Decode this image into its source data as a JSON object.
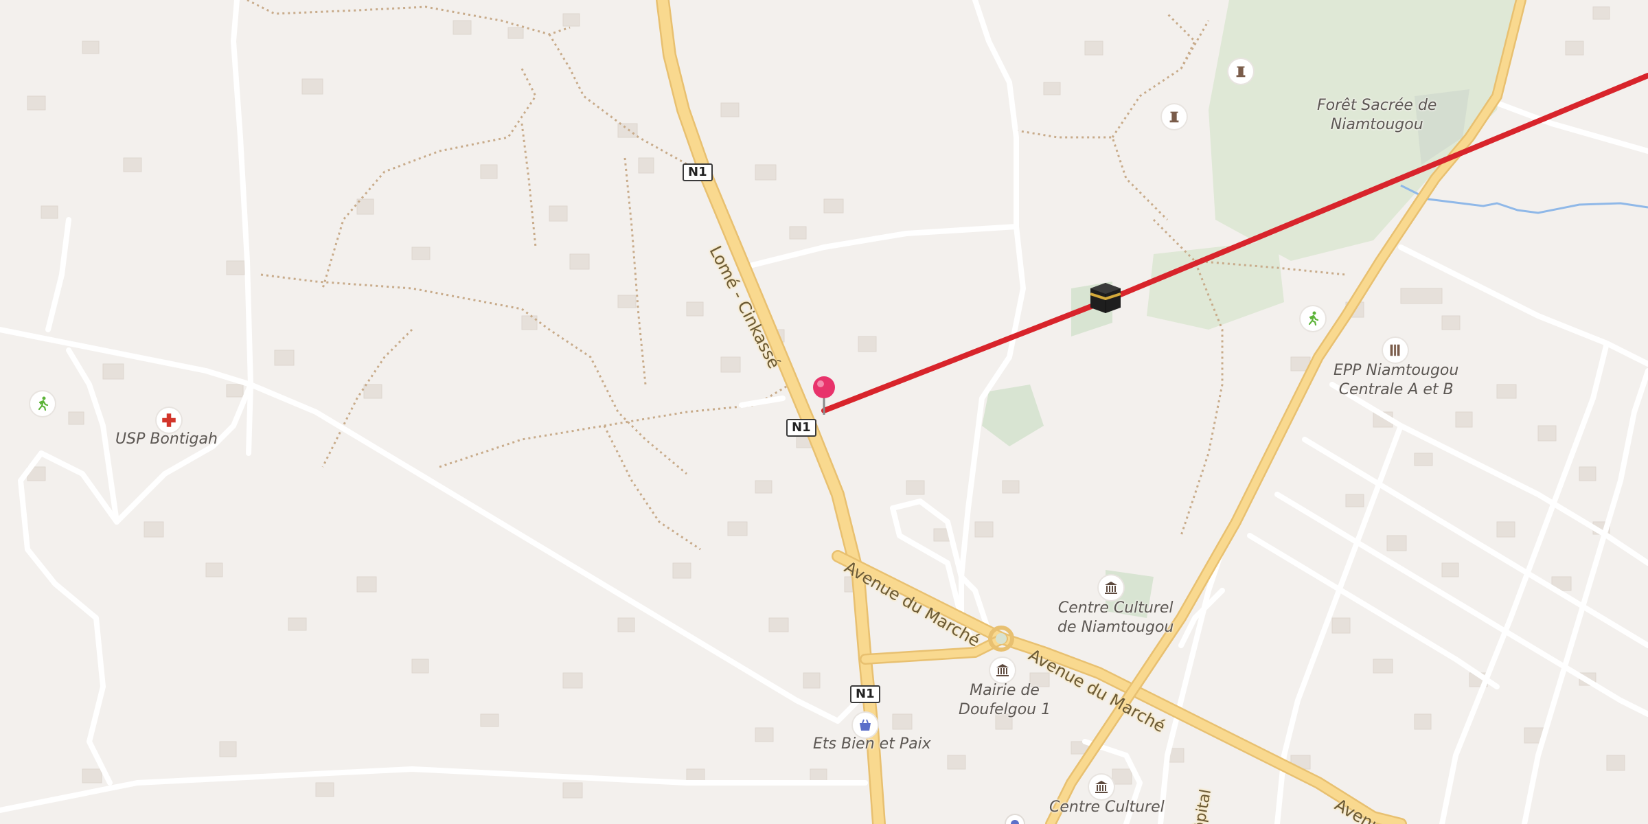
{
  "map": {
    "road_labels": {
      "lome_cinkasse": "Lomé - Cinkassé",
      "avenue_marche_1": "Avenue du Marché",
      "avenue_marche_2": "Avenue du Marché",
      "avenue_bottom": "Avenue",
      "hopital": "ôpital"
    },
    "shields": {
      "n1_top": "N1",
      "n1_mid": "N1",
      "n1_bottom": "N1"
    },
    "places": {
      "usp_bontigah": "USP Bontigah",
      "foret_line1": "Forêt Sacrée de",
      "foret_line2": "Niamtougou",
      "epp_line1": "EPP Niamtougou",
      "epp_line2": "Centrale A et B",
      "centre_culturel_line1": "Centre Culturel",
      "centre_culturel_line2": "de Niamtougou",
      "mairie_line1": "Mairie de",
      "mairie_line2": "Doufelgou 1",
      "ets_bien_paix": "Ets Bien et Paix",
      "centre_culturel_bottom": "Centre Culturel"
    },
    "icons": [
      "sports-icon",
      "hospital-icon",
      "memorial-icon",
      "monument-icon",
      "kaaba-icon",
      "school-icon",
      "museum-icon",
      "town-hall-icon",
      "shop-icon",
      "map-pin-icon"
    ],
    "colors": {
      "background": "#f3f0ed",
      "primary_road": "#f9d98f",
      "route_line": "#d8242b",
      "pin": "#e8336b",
      "forest": "#dfe8d6",
      "water": "#8fb8e8"
    }
  }
}
